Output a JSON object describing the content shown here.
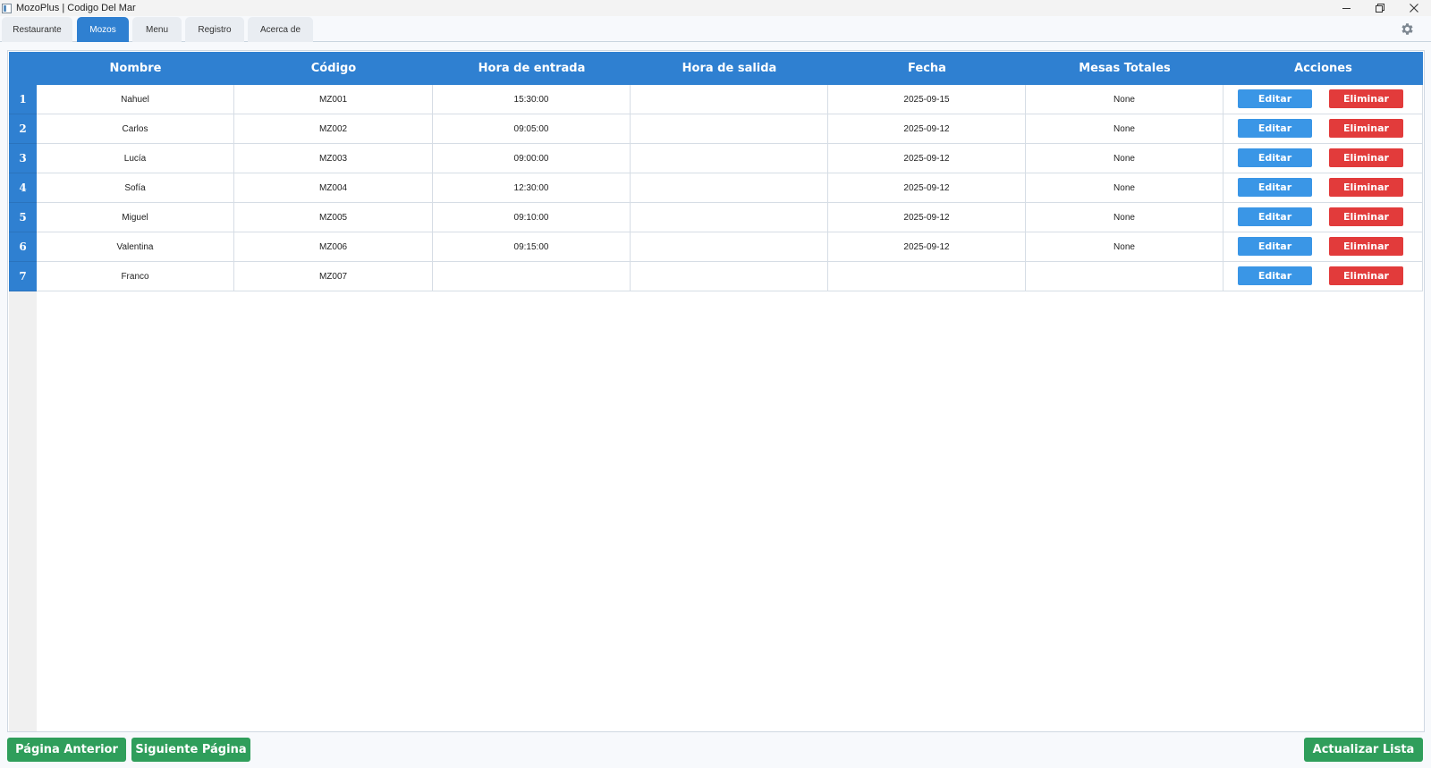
{
  "window": {
    "title": "MozoPlus | Codigo Del Mar"
  },
  "tabs": [
    {
      "label": "Restaurante",
      "active": false
    },
    {
      "label": "Mozos",
      "active": true
    },
    {
      "label": "Menu",
      "active": false
    },
    {
      "label": "Registro",
      "active": false
    },
    {
      "label": "Acerca de",
      "active": false
    }
  ],
  "settings": {
    "icon": "gear-icon"
  },
  "table": {
    "columns": [
      "Nombre",
      "Código",
      "Hora de entrada",
      "Hora de salida",
      "Fecha",
      "Mesas Totales",
      "Acciones"
    ],
    "rows": [
      {
        "num": "1",
        "nombre": "Nahuel",
        "codigo": "MZ001",
        "entrada": "15:30:00",
        "salida": "",
        "fecha": "2025-09-15",
        "mesas": "None"
      },
      {
        "num": "2",
        "nombre": "Carlos",
        "codigo": "MZ002",
        "entrada": "09:05:00",
        "salida": "",
        "fecha": "2025-09-12",
        "mesas": "None"
      },
      {
        "num": "3",
        "nombre": "Lucía",
        "codigo": "MZ003",
        "entrada": "09:00:00",
        "salida": "",
        "fecha": "2025-09-12",
        "mesas": "None"
      },
      {
        "num": "4",
        "nombre": "Sofía",
        "codigo": "MZ004",
        "entrada": "12:30:00",
        "salida": "",
        "fecha": "2025-09-12",
        "mesas": "None"
      },
      {
        "num": "5",
        "nombre": "Miguel",
        "codigo": "MZ005",
        "entrada": "09:10:00",
        "salida": "",
        "fecha": "2025-09-12",
        "mesas": "None"
      },
      {
        "num": "6",
        "nombre": "Valentina",
        "codigo": "MZ006",
        "entrada": "09:15:00",
        "salida": "",
        "fecha": "2025-09-12",
        "mesas": "None"
      },
      {
        "num": "7",
        "nombre": "Franco",
        "codigo": "MZ007",
        "entrada": "",
        "salida": "",
        "fecha": "",
        "mesas": ""
      }
    ],
    "edit_label": "Editar",
    "delete_label": "Eliminar"
  },
  "footer": {
    "prev_label": "Página Anterior",
    "next_label": "Siguiente Página",
    "refresh_label": "Actualizar Lista"
  },
  "colors": {
    "accent": "#2f80d1",
    "edit": "#3a96e6",
    "delete": "#e23b3b",
    "footer_button": "#2f9e5b"
  }
}
